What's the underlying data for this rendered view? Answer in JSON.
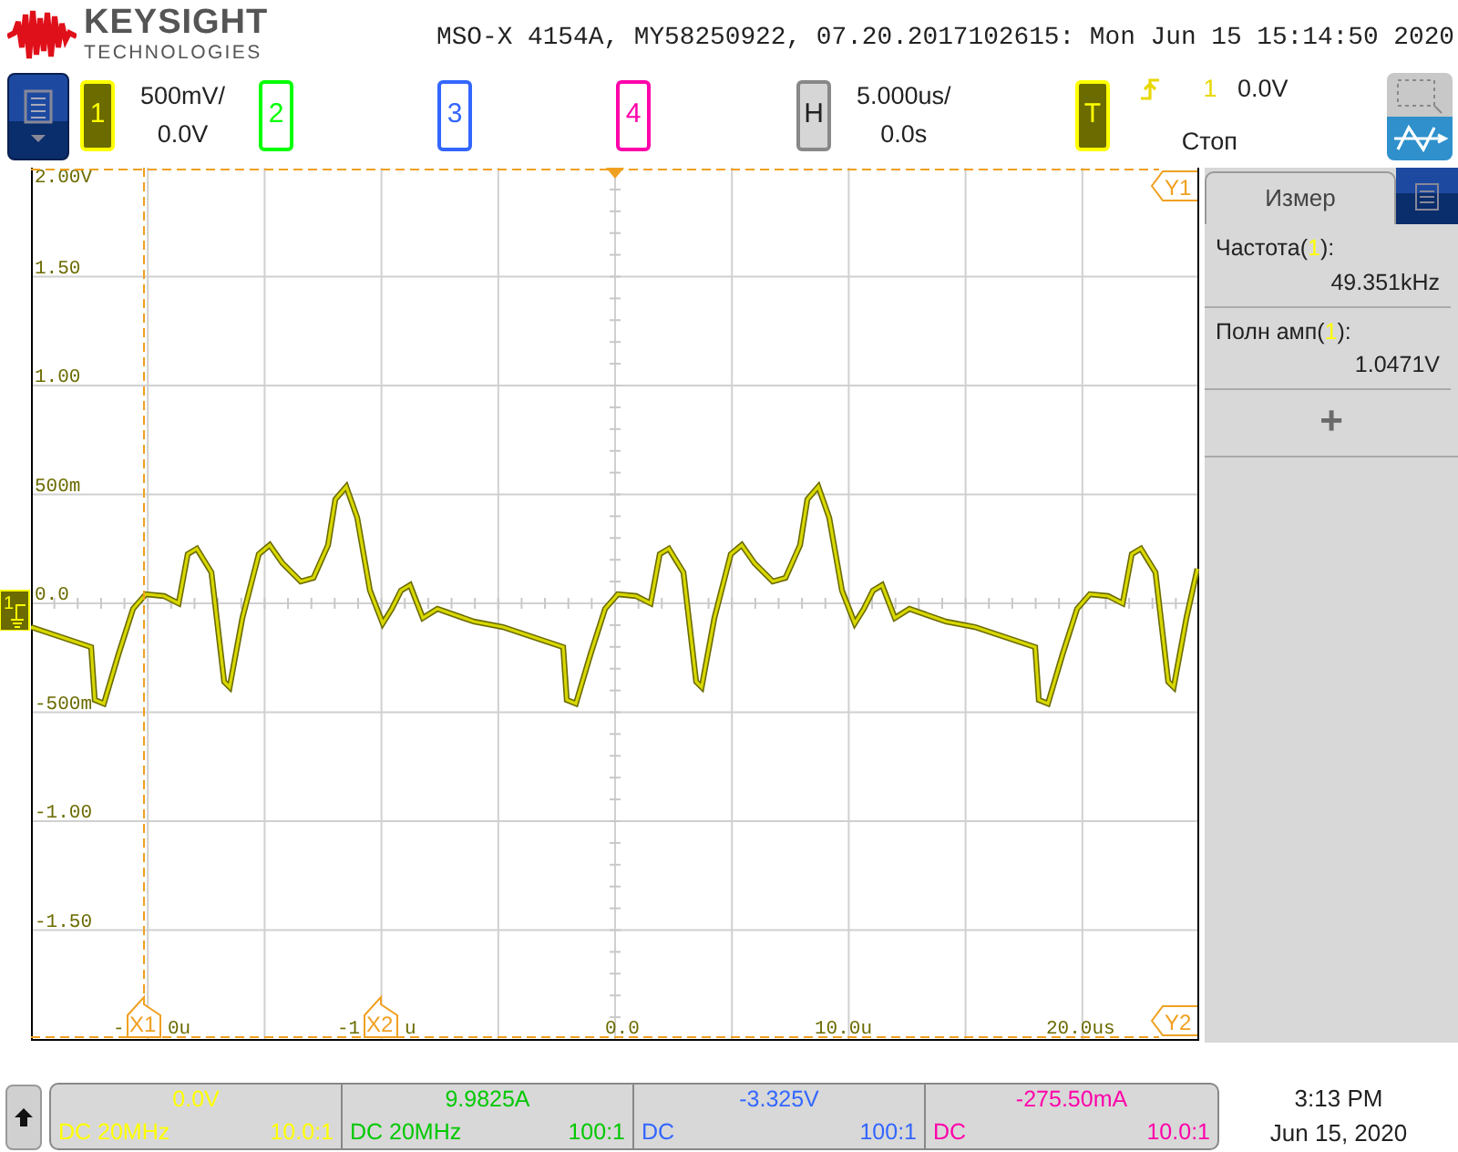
{
  "header": {
    "brand": "KEYSIGHT",
    "brand_sub": "TECHNOLOGIES",
    "title": "MSO-X 4154A, MY58250922, 07.20.2017102615: Mon Jun 15 15:14:50 2020"
  },
  "channels": [
    {
      "label": "1",
      "on": true,
      "color": "#ffff00",
      "scale": "500mV/",
      "offset": "0.0V"
    },
    {
      "label": "2",
      "on": false,
      "color": "#00ff00"
    },
    {
      "label": "3",
      "on": false,
      "color": "#3366ff"
    },
    {
      "label": "4",
      "on": false,
      "color": "#ff00aa"
    }
  ],
  "horizontal": {
    "label": "H",
    "scale": "5.000us/",
    "delay": "0.0s"
  },
  "trigger": {
    "label": "T",
    "source": "1",
    "level": "0.0V",
    "status": "Стоп"
  },
  "plot": {
    "y_labels": [
      "2.00V",
      "1.50",
      "1.00",
      "500m",
      "0.0",
      "-500m",
      "-1.00",
      "-1.50"
    ],
    "x_labels": [
      "-",
      "0u",
      "-1",
      "u",
      "0.0",
      "10.0u",
      "20.0us"
    ],
    "cursors": [
      {
        "label": "Y1",
        "kind": "y"
      },
      {
        "label": "X1",
        "kind": "x"
      },
      {
        "label": "X2",
        "kind": "x"
      },
      {
        "label": "Y2",
        "kind": "y"
      }
    ],
    "ground_marker": "1"
  },
  "measure": {
    "tab": "Измер",
    "items": [
      {
        "name": "Частота(",
        "source": "1",
        "suffix": "):",
        "value": "49.351kHz"
      },
      {
        "name": "Полн амп(",
        "source": "1",
        "suffix": "):",
        "value": "1.0471V"
      }
    ],
    "add": "+"
  },
  "status_bar": {
    "channels": [
      {
        "value": "0.0V",
        "coupling": "DC 20MHz",
        "probe": "10.0:1",
        "color": "#ffff00"
      },
      {
        "value": "9.9825A",
        "coupling": "DC 20MHz",
        "probe": "100:1",
        "color": "#00c800"
      },
      {
        "value": "-3.325V",
        "coupling": "DC",
        "probe": "100:1",
        "color": "#3366ff"
      },
      {
        "value": "-275.50mA",
        "coupling": "DC",
        "probe": "10.0:1",
        "color": "#ff00aa"
      }
    ],
    "time": "3:13 PM",
    "date": "Jun 15, 2020"
  }
}
